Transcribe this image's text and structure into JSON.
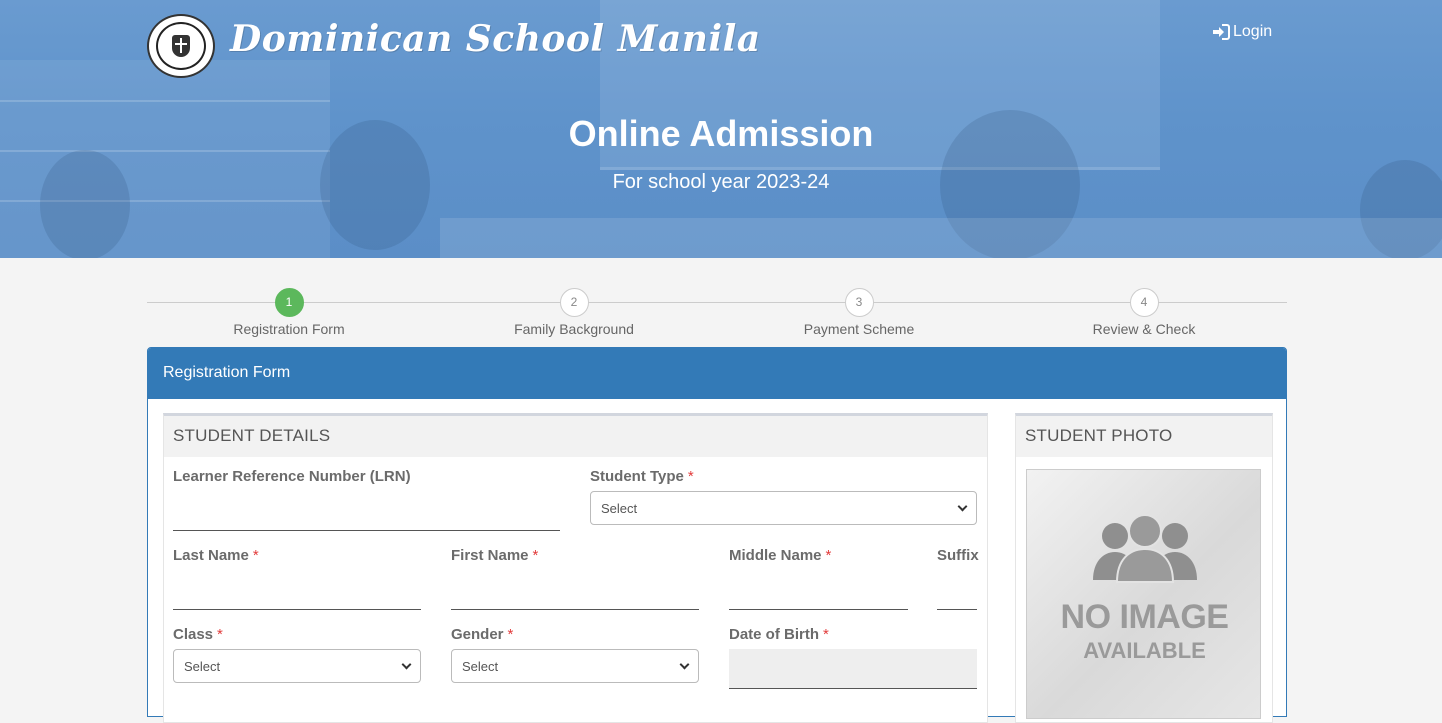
{
  "header": {
    "school_name": "Dominican School Manila",
    "login_label": "Login",
    "title": "Online Admission",
    "subtitle": "For school year 2023-24"
  },
  "steps": [
    {
      "num": "1",
      "label": "Registration Form",
      "active": true
    },
    {
      "num": "2",
      "label": "Family Background",
      "active": false
    },
    {
      "num": "3",
      "label": "Payment Scheme",
      "active": false
    },
    {
      "num": "4",
      "label": "Review & Check",
      "active": false
    }
  ],
  "panel": {
    "title": "Registration Form"
  },
  "student_details": {
    "heading": "STUDENT DETAILS",
    "lrn_label": "Learner Reference Number (LRN)",
    "student_type_label": "Student Type",
    "student_type_value": "Select",
    "last_name_label": "Last Name",
    "first_name_label": "First Name",
    "middle_name_label": "Middle Name",
    "suffix_label": "Suffix",
    "class_label": "Class",
    "class_value": "Select",
    "gender_label": "Gender",
    "gender_value": "Select",
    "dob_label": "Date of Birth",
    "required_mark": "*"
  },
  "student_photo": {
    "heading": "STUDENT PHOTO",
    "placeholder_line1": "NO IMAGE",
    "placeholder_line2": "AVAILABLE"
  },
  "colors": {
    "hero": "#5f93cb",
    "primary": "#337ab7",
    "active_step": "#5cb85c",
    "required": "#e23b3b"
  }
}
